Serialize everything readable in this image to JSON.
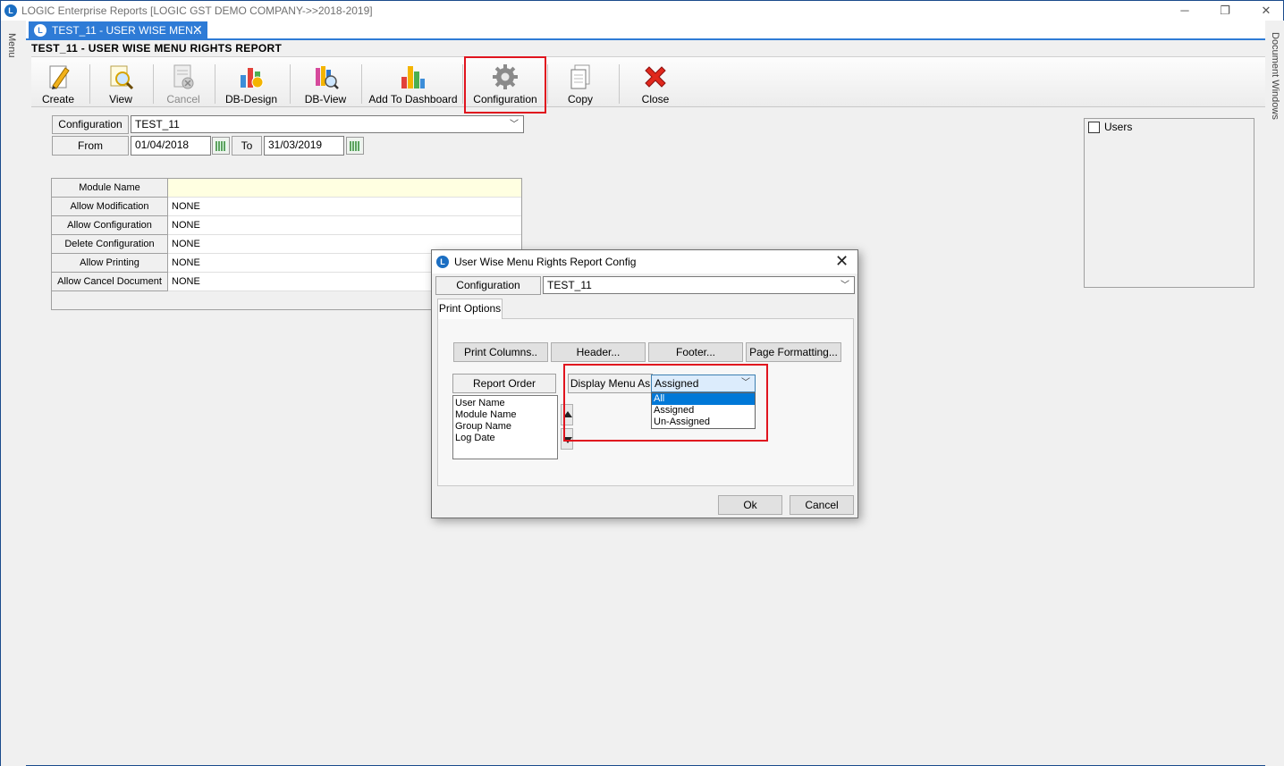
{
  "app": {
    "title": "LOGIC Enterprise Reports  [LOGIC GST DEMO COMPANY->>2018-2019]",
    "icon": "logic-app-icon",
    "window_controls": [
      "minimize",
      "restore",
      "close"
    ]
  },
  "rails": {
    "left_label": "Menu",
    "right_label": "Document Windows"
  },
  "doc_tab": {
    "label": "TEST_11 - USER WISE MEN...",
    "close": "✕"
  },
  "report": {
    "title": "TEST_11 - USER WISE MENU RIGHTS REPORT"
  },
  "toolbar": {
    "create": "Create",
    "view": "View",
    "cancel": "Cancel",
    "db_design": "DB-Design",
    "db_view": "DB-View",
    "add_dashboard": "Add To Dashboard",
    "configuration": "Configuration",
    "copy": "Copy",
    "close": "Close"
  },
  "filters": {
    "configuration_label": "Configuration",
    "configuration_value": "TEST_11",
    "from_label": "From",
    "from_value": "01/04/2018",
    "to_label": "To",
    "to_value": "31/03/2019"
  },
  "grid": {
    "rows": [
      {
        "label": "Module Name",
        "value": ""
      },
      {
        "label": "Allow Modification",
        "value": "NONE"
      },
      {
        "label": "Allow Configuration",
        "value": "NONE"
      },
      {
        "label": "Delete Configuration",
        "value": "NONE"
      },
      {
        "label": "Allow Printing",
        "value": "NONE"
      },
      {
        "label": "Allow Cancel Document",
        "value": "NONE"
      }
    ]
  },
  "users_panel": {
    "label": "Users",
    "checked": false
  },
  "dialog": {
    "title": "User Wise Menu Rights Report Config",
    "configuration_label": "Configuration",
    "configuration_value": "TEST_11",
    "tab_label": "Print Options",
    "buttons": {
      "print_columns": "Print Columns..",
      "header": "Header...",
      "footer": "Footer...",
      "page_formatting": "Page Formatting..."
    },
    "report_order_label": "Report Order",
    "report_order_items": [
      "User Name",
      "Module Name",
      "Group Name",
      "Log Date"
    ],
    "display_menu_label": "Display Menu As",
    "display_menu_value": "Assigned",
    "display_menu_options": [
      "All",
      "Assigned",
      "Un-Assigned"
    ],
    "display_menu_highlighted": "All",
    "ok": "Ok",
    "cancel": "Cancel"
  },
  "colors": {
    "accent": "#2e7bd6",
    "highlight_box": "#e0141e",
    "selection": "#0078d7",
    "grid_yellow": "#ffffe1"
  }
}
